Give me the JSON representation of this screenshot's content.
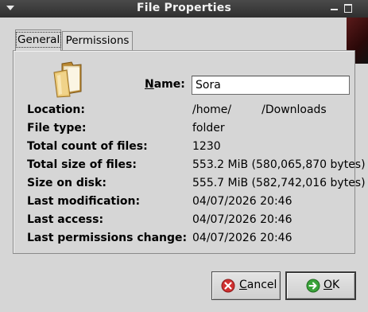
{
  "window": {
    "title": "File Properties"
  },
  "tabs": [
    {
      "label": "General",
      "active": true
    },
    {
      "label": "Permissions",
      "active": false
    }
  ],
  "general": {
    "folder_icon": "folder-icon",
    "name_label": "Name:",
    "name_value": "Sora",
    "properties": [
      {
        "label": "Location:",
        "value_parts": [
          "/home/",
          "/Downloads"
        ]
      },
      {
        "label": "File type:",
        "value": "folder"
      },
      {
        "label": "Total count of files:",
        "value": "1230"
      },
      {
        "label": "Total size of files:",
        "value": "553.2 MiB (580,065,870 bytes)"
      },
      {
        "label": "Size on disk:",
        "value": "555.7 MiB (582,742,016 bytes)"
      },
      {
        "label": "Last modification:",
        "value": "04/07/2026 20:46"
      },
      {
        "label": "Last access:",
        "value": "04/07/2026 20:46"
      },
      {
        "label": "Last permissions change:",
        "value": "04/07/2026 20:46"
      }
    ]
  },
  "buttons": {
    "cancel": {
      "label_first": "C",
      "label_rest": "ancel",
      "icon": "cancel-icon"
    },
    "ok": {
      "label_first": "O",
      "label_rest": "K",
      "icon": "ok-icon"
    }
  },
  "colors": {
    "titlebar": "#2f2f2f",
    "dialog_bg": "#d6d6d6",
    "cancel_icon": "#d03030",
    "ok_icon": "#3aa33a"
  }
}
